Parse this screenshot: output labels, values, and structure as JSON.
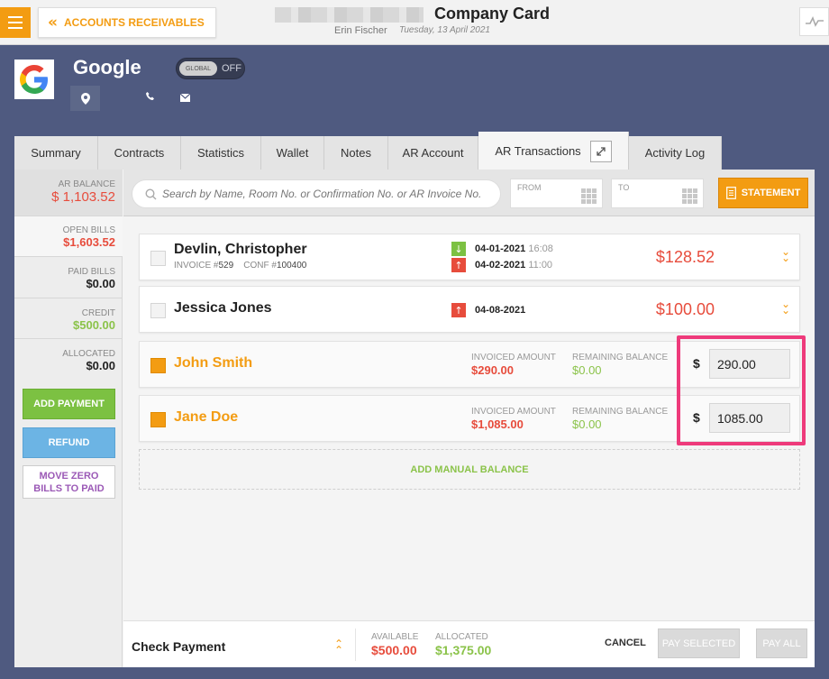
{
  "topbar": {
    "back_label": "ACCOUNTS RECEIVABLES",
    "title": "Company Card",
    "user": "Erin Fischer",
    "date": "Tuesday, 13 April 2021"
  },
  "company": {
    "name": "Google",
    "global_label": "GLOBAL",
    "global_state": "OFF"
  },
  "tabs": [
    {
      "label": "Summary"
    },
    {
      "label": "Contracts"
    },
    {
      "label": "Statistics"
    },
    {
      "label": "Wallet"
    },
    {
      "label": "Notes"
    },
    {
      "label": "AR Account"
    },
    {
      "label": "AR Transactions"
    },
    {
      "label": "Activity Log"
    }
  ],
  "sidebar": {
    "ar_balance": {
      "label": "AR BALANCE",
      "value": "$ 1,103.52"
    },
    "open_bills": {
      "label": "OPEN BILLS",
      "value": "$1,603.52"
    },
    "paid_bills": {
      "label": "PAID BILLS",
      "value": "$0.00"
    },
    "credit": {
      "label": "CREDIT",
      "value": "$500.00"
    },
    "allocated": {
      "label": "ALLOCATED",
      "value": "$0.00"
    },
    "add_payment": "ADD PAYMENT",
    "refund": "REFUND",
    "move_zero": "MOVE ZERO BILLS TO PAID"
  },
  "toolbar": {
    "search_placeholder": "Search by Name, Room No. or Confirmation No. or AR Invoice No.",
    "from_label": "FROM",
    "to_label": "TO",
    "statement_label": "STATEMENT"
  },
  "bills": [
    {
      "name": "Devlin, Christopher",
      "invoice_label": "INVOICE #",
      "invoice": "529",
      "conf_label": "CONF #",
      "conf": "100400",
      "arrive_date": "04-01-2021",
      "arrive_time": "16:08",
      "depart_date": "04-02-2021",
      "depart_time": "11:00",
      "amount": "$128.52"
    },
    {
      "name": "Jessica Jones",
      "depart_date": "04-08-2021",
      "amount": "$100.00"
    }
  ],
  "allocations": [
    {
      "name": "John Smith",
      "invoiced_label": "INVOICED AMOUNT",
      "invoiced": "$290.00",
      "remaining_label": "REMAINING BALANCE",
      "remaining": "$0.00",
      "currency": "$",
      "input_value": "290.00"
    },
    {
      "name": "Jane Doe",
      "invoiced_label": "INVOICED AMOUNT",
      "invoiced": "$1,085.00",
      "remaining_label": "REMAINING BALANCE",
      "remaining": "$0.00",
      "currency": "$",
      "input_value": "1085.00"
    }
  ],
  "manual_balance": "ADD MANUAL BALANCE",
  "bottom": {
    "title": "Check Payment",
    "available_label": "AVAILABLE",
    "available": "$500.00",
    "allocated_label": "ALLOCATED",
    "allocated": "$1,375.00",
    "cancel": "CANCEL",
    "pay_selected": "PAY SELECTED",
    "pay_all": "PAY ALL"
  },
  "colors": {
    "accent": "#f39c12",
    "header_bg": "#4f5a80",
    "negative": "#e74c3c",
    "positive": "#8bc34a",
    "highlight": "#ee3a7b"
  }
}
